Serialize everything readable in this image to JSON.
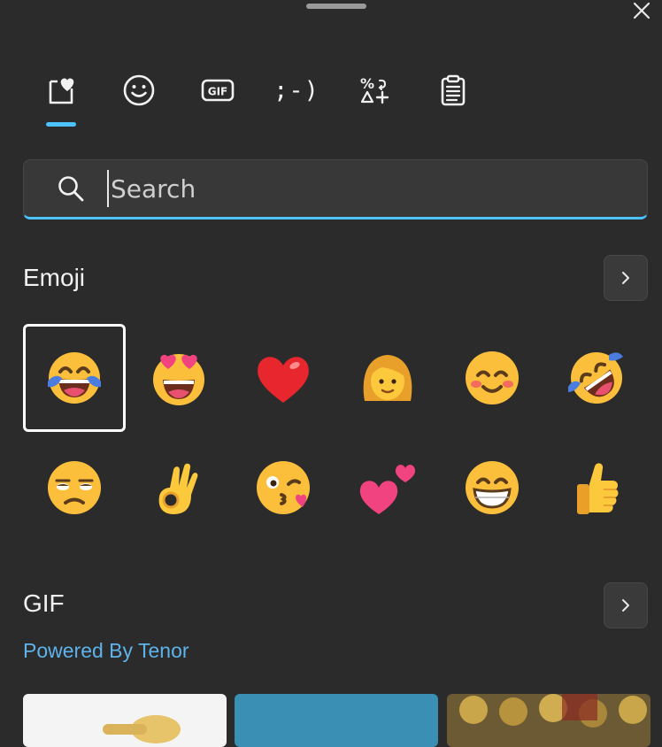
{
  "tabs": [
    {
      "name": "recent-favorites",
      "label": ""
    },
    {
      "name": "emoji",
      "label": ""
    },
    {
      "name": "gif",
      "label": "GIF"
    },
    {
      "name": "kaomoji",
      "label": ";-)"
    },
    {
      "name": "symbols",
      "label": ""
    },
    {
      "name": "clipboard",
      "label": ""
    }
  ],
  "active_tab": "recent-favorites",
  "search": {
    "placeholder": "Search",
    "value": ""
  },
  "emoji_section": {
    "title": "Emoji",
    "items": [
      {
        "name": "face-with-tears-of-joy",
        "selected": true
      },
      {
        "name": "smiling-face-with-heart-eyes"
      },
      {
        "name": "red-heart"
      },
      {
        "name": "woman"
      },
      {
        "name": "smiling-face-with-smiling-eyes"
      },
      {
        "name": "rolling-on-the-floor-laughing"
      },
      {
        "name": "unamused-face"
      },
      {
        "name": "ok-hand"
      },
      {
        "name": "face-blowing-a-kiss"
      },
      {
        "name": "two-hearts"
      },
      {
        "name": "beaming-face-with-smiling-eyes"
      },
      {
        "name": "thumbs-up"
      }
    ]
  },
  "gif_section": {
    "title": "GIF",
    "powered_by": "Powered By Tenor"
  },
  "colors": {
    "background": "#2b2b2b",
    "accent": "#4cc2ff",
    "link": "#5db3ea"
  }
}
